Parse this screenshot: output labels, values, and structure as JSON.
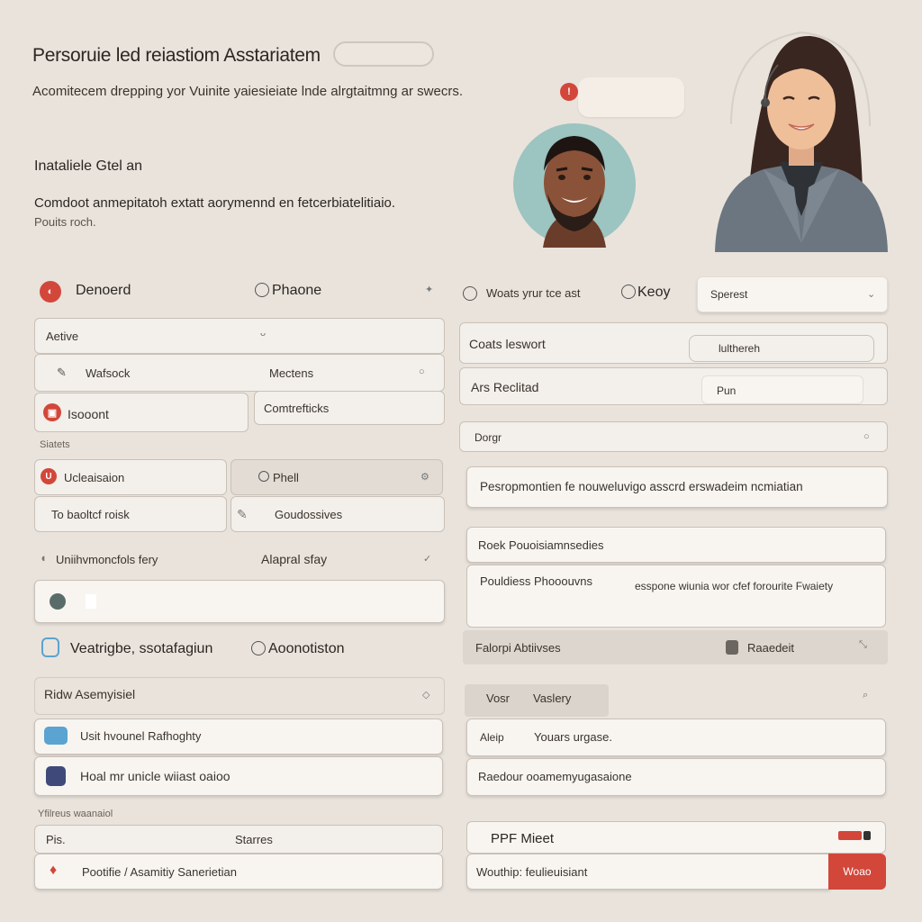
{
  "header": {
    "title": "Persoruie led reiastiom Asstariatem",
    "subtitle": "Acomitecem drepping yor Vuinite yaiesieiate lnde alrgtaitmng ar swecrs."
  },
  "intro": {
    "heading": "Inataliele Gtel an",
    "line1": "Comdoot anmepitatoh extatt aorymennd en fetcerbiatelitiaio.",
    "line2": "Pouits roch."
  },
  "left": {
    "row1": {
      "left_label": "Denoerd",
      "right_label": "Phaone",
      "more_icon": "sparkle"
    },
    "field_active": "Aetive",
    "row2": {
      "left": "Wafsock",
      "right": "Mectens"
    },
    "row3": {
      "left": "Isooont",
      "right": "Comtrefticks"
    },
    "section_label": "Siatets",
    "row4": {
      "left": "Ucleaisaion",
      "right": "Phell"
    },
    "row5": {
      "left": "To baoltcf roisk",
      "right": "Goudossives"
    },
    "row6": {
      "left": "Uniihvmoncfols fery",
      "right": "Alapral sfay"
    },
    "headline": {
      "left": "Veatrigbe, ssotafagiun",
      "right": "Aoonotiston"
    },
    "asm_field": "Ridw Asemyisiel",
    "list1": "Usit hvounel Rafhoghty",
    "list2": "Hoal mr unicle wiiast oaioo",
    "mini_label": "Yfilreus waanaiol",
    "field_p": "Pis.",
    "field_p_right": "Starres",
    "bottom_field": "Pootifie / Asamitiy Sanerietian"
  },
  "right": {
    "row1": {
      "left": "Woats yrur tce ast",
      "mid": "Keoy",
      "search": "Sperest"
    },
    "combo1": {
      "label": "Coats leswort",
      "value": "lulthereh"
    },
    "combo2": {
      "label": "Ars Reclitad",
      "value": "Pun"
    },
    "dropdown": "Dorgr",
    "text_block": "Pesropmontien fe nouweluvigo asscrd erswadeim ncmiatian",
    "rows": [
      {
        "text": "Roek Pouoisiamnsedies"
      },
      {
        "text": "Pouldiess Phooouvns",
        "extra": "esspone wiunia wor cfef forourite Fwaiety"
      }
    ],
    "band": {
      "left": "Falorpi Abtiivses",
      "right": "Raaedeit"
    },
    "tabs": {
      "first": "Vosr",
      "second": "Vaslery"
    },
    "list1": {
      "left": "Aleip",
      "right": "Youars urgase."
    },
    "list2": "Raedour ooamemyugasaione",
    "pdf_label": "PPF Mieet",
    "pdf_field": "Wouthip: feulieuisiant",
    "button": "Woao"
  },
  "colors": {
    "accent": "#d2473a",
    "bg": "#e9e3dc",
    "field": "#f3efea",
    "border": "#c9c1b8",
    "blue": "#5ba3d0",
    "navy": "#3f4a7a"
  }
}
